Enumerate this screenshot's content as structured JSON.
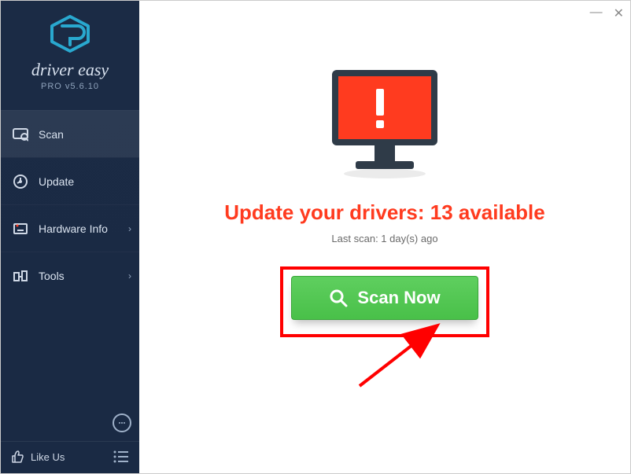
{
  "app": {
    "brand": "driver easy",
    "version_label": "PRO v5.6.10"
  },
  "sidebar": {
    "items": [
      {
        "label": "Scan",
        "icon": "scan",
        "active": true,
        "hasSub": false
      },
      {
        "label": "Update",
        "icon": "update",
        "active": false,
        "hasSub": false
      },
      {
        "label": "Hardware Info",
        "icon": "hardware",
        "active": false,
        "hasSub": true
      },
      {
        "label": "Tools",
        "icon": "tools",
        "active": false,
        "hasSub": true
      }
    ],
    "like_label": "Like Us"
  },
  "main": {
    "headline": "Update your drivers: 13 available",
    "last_scan": "Last scan: 1 day(s) ago",
    "scan_button_label": "Scan Now"
  },
  "colors": {
    "alert": "#ff3b1f",
    "scan_green": "#4cc24c",
    "highlight_red": "#ff0000",
    "sidebar_bg": "#1b2b45",
    "accent_cyan": "#29a8cf"
  }
}
